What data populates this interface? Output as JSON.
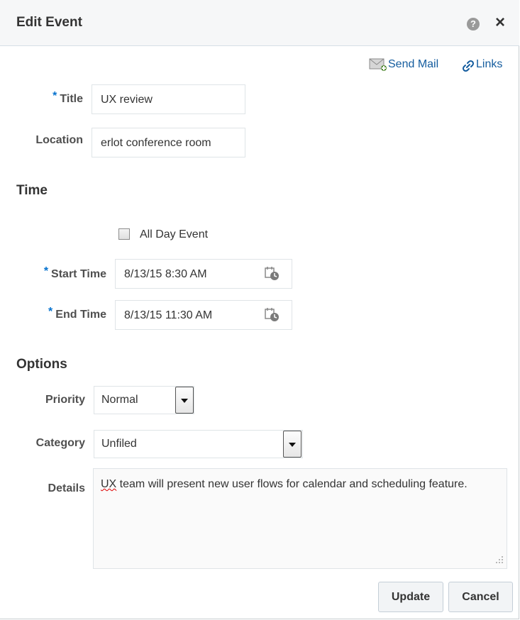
{
  "dialog": {
    "title": "Edit Event",
    "help_icon": "?",
    "close_icon": "×"
  },
  "links": {
    "send_mail": "Send Mail",
    "links": "Links"
  },
  "form": {
    "required_marker": "*",
    "title_label": "Title",
    "title_value": "UX review",
    "location_label": "Location",
    "location_value": "erlot conference room",
    "time_section": "Time",
    "all_day_label": "All Day Event",
    "start_time_label": "Start Time",
    "start_time_value": "8/13/15 8:30 AM",
    "end_time_label": "End Time",
    "end_time_value": "8/13/15 11:30 AM",
    "options_section": "Options",
    "priority_label": "Priority",
    "priority_value": "Normal",
    "category_label": "Category",
    "category_value": "Unfiled",
    "details_label": "Details",
    "details_first_word": "UX",
    "details_rest": " team will present new user flows for calendar and scheduling feature."
  },
  "buttons": {
    "update": "Update",
    "cancel": "Cancel"
  },
  "colors": {
    "link": "#145c9e",
    "required": "#0572ce",
    "header_bg": "#f6f7f8"
  }
}
